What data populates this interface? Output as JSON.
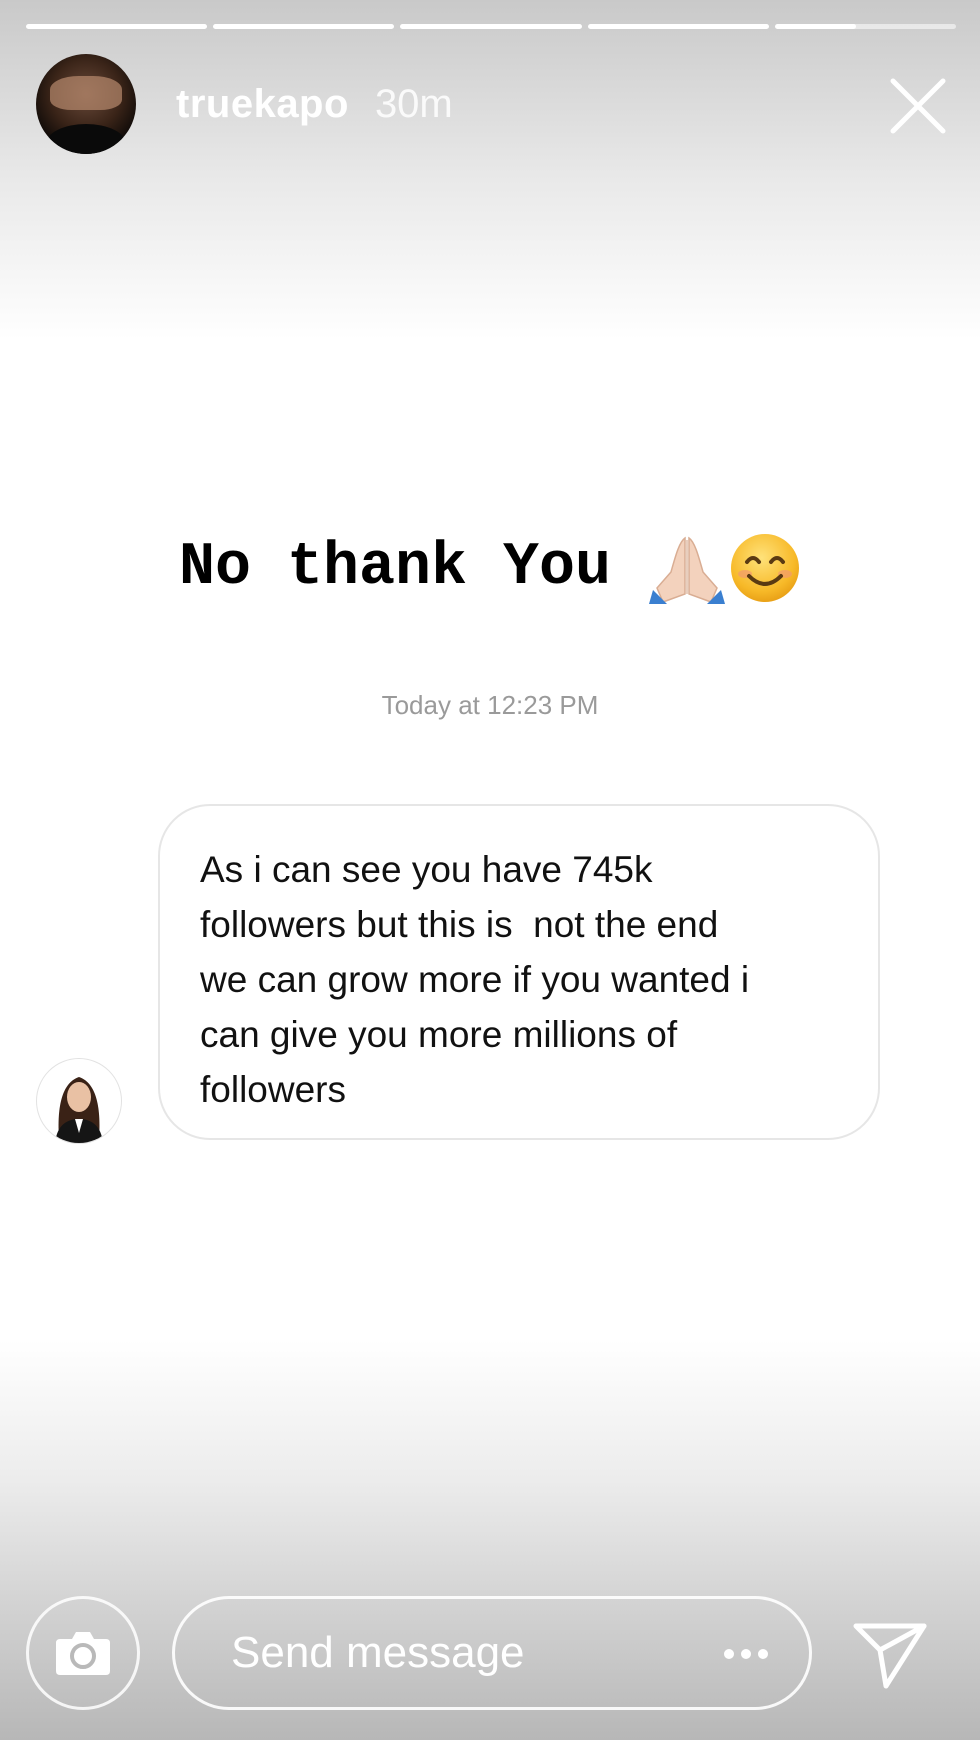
{
  "story": {
    "segments": [
      {
        "progress": 1.0
      },
      {
        "progress": 1.0
      },
      {
        "progress": 1.0
      },
      {
        "progress": 1.0
      },
      {
        "progress": 0.45
      }
    ]
  },
  "header": {
    "username": "truekapo",
    "time_ago": "30m",
    "avatar_icon": "profile-avatar",
    "close_icon": "close-icon"
  },
  "caption": {
    "text": "No thank You",
    "emojis": [
      "folded-hands-emoji",
      "smiling-face-emoji"
    ]
  },
  "dm": {
    "timestamp": "Today at 12:23 PM",
    "message_lines": [
      "As i can see you have 745k",
      "followers but this is  not the end",
      "we can grow more if you wanted i",
      "can give you more millions of",
      "followers"
    ]
  },
  "bottom": {
    "camera_icon": "camera-icon",
    "input_placeholder": "Send message",
    "more_icon": "more-dots-icon",
    "send_icon": "send-icon"
  },
  "colors": {
    "text_primary": "#000000",
    "timestamp": "#9a9a9a",
    "bubble_border": "#e6e6e6",
    "overlay_white": "#ffffff"
  }
}
